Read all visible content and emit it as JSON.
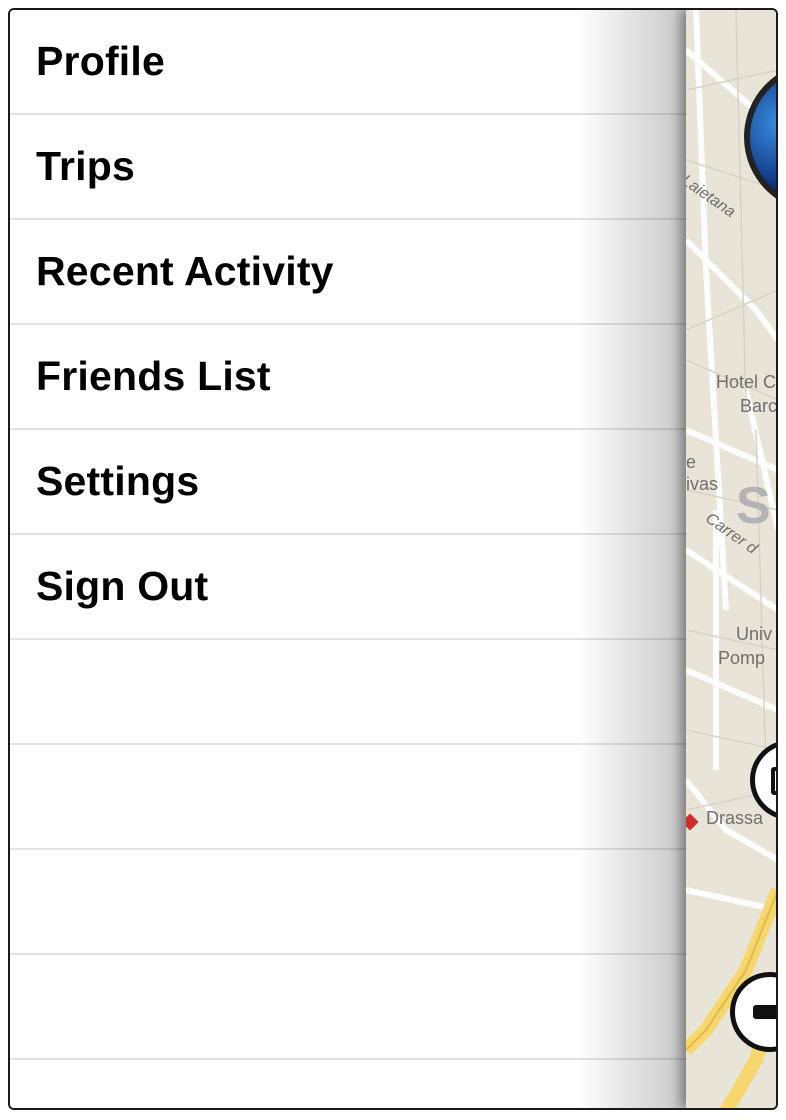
{
  "menu": {
    "items": [
      {
        "label": "Profile"
      },
      {
        "label": "Trips"
      },
      {
        "label": "Recent Activity"
      },
      {
        "label": "Friends List"
      },
      {
        "label": "Settings"
      },
      {
        "label": "Sign Out"
      },
      {
        "label": ""
      },
      {
        "label": ""
      },
      {
        "label": ""
      },
      {
        "label": ""
      }
    ]
  },
  "map": {
    "labels": {
      "street_laietana": "Laietana",
      "hotel": "Hotel C",
      "hotel_line2": "Barc",
      "e": "e",
      "ivas": "ivas",
      "carrer": "Carrer d",
      "big_s": "S",
      "univ": "Univ",
      "pomp": "Pomp",
      "drassanes": "Drassa"
    },
    "colors": {
      "background": "#e9e4d8",
      "road": "#ffffff",
      "highway": "#f5d76e"
    }
  }
}
